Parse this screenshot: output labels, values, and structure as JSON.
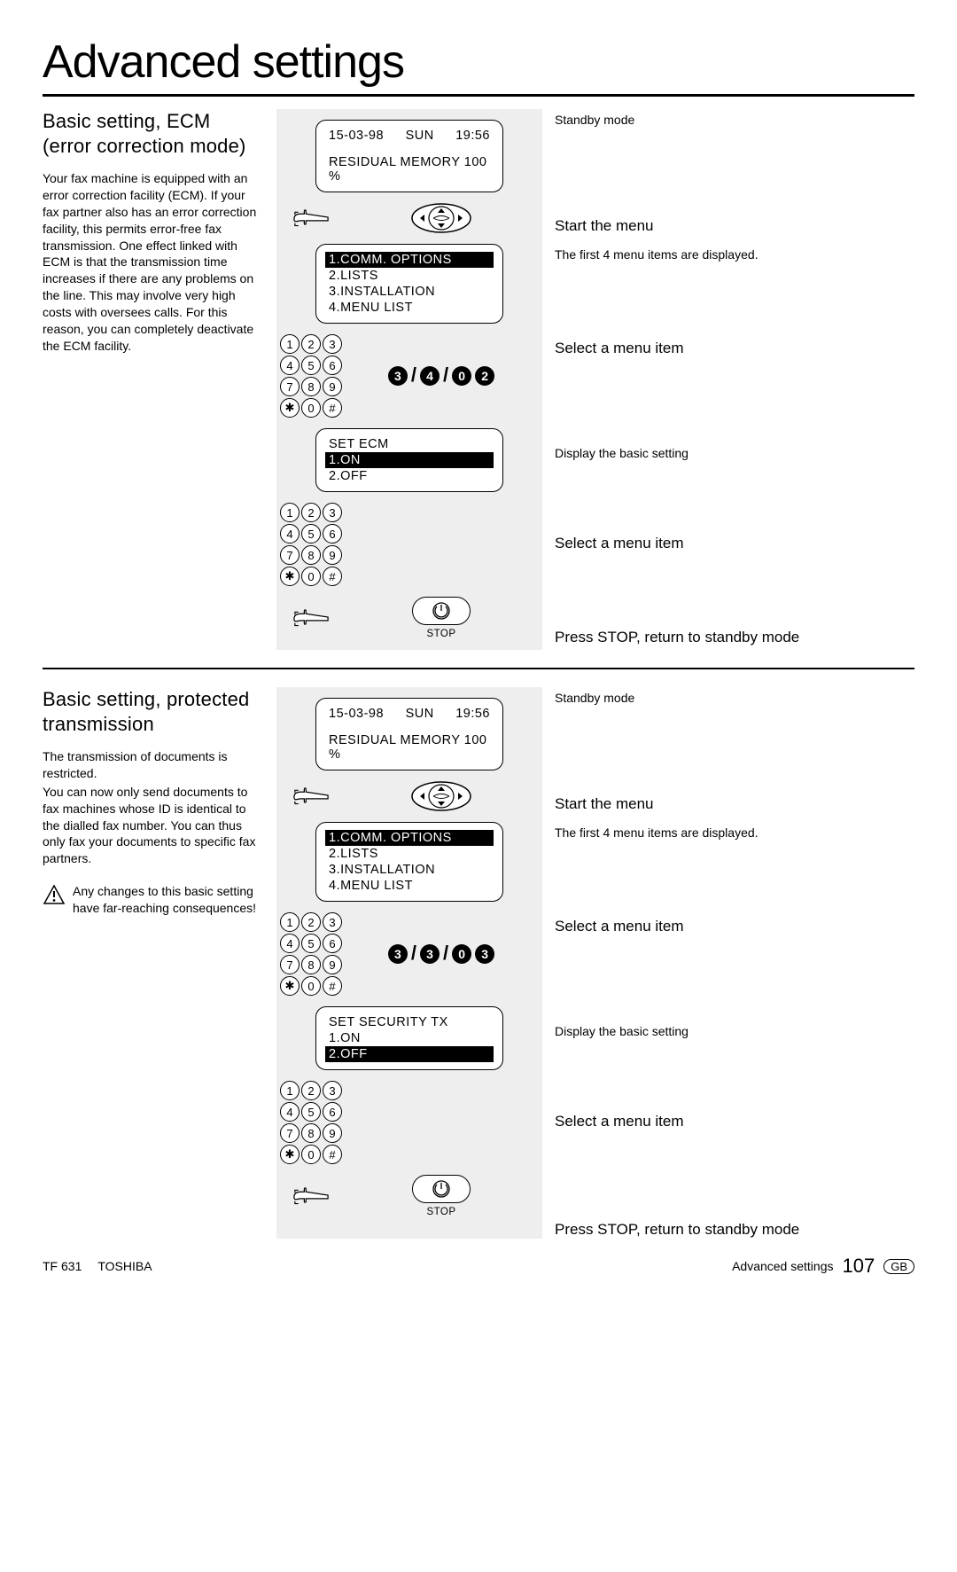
{
  "page_title": "Advanced settings",
  "section1": {
    "heading": "Basic setting, ECM (error correction mode)",
    "body": "Your fax machine is equipped with an error correction facility (ECM). If your fax partner also has an error correction facility, this permits error-free fax transmission. One effect linked with ECM is that the transmission time increases if there are any problems on the line. This may involve very high costs with oversees calls. For this reason, you can completely deactivate the ECM facility."
  },
  "section2": {
    "heading": "Basic setting, protected transmission",
    "body1": "The transmission of documents is restricted.",
    "body2": "You can now only send documents to fax machines whose ID is identical to the dialled fax number. You can thus only fax your documents to specific fax partners.",
    "warning": "Any changes to this basic setting have far-reaching consequences!"
  },
  "lcd_header": {
    "date": "15-03-98",
    "day": "SUN",
    "time": "19:56",
    "memory": "RESIDUAL MEMORY 100 %"
  },
  "menu_list": {
    "item1": "1.COMM. OPTIONS",
    "item2": "2.LISTS",
    "item3": "3.INSTALLATION",
    "item4": "4.MENU LIST"
  },
  "ecm_box": {
    "title": "SET ECM",
    "opt1": "1.ON",
    "opt2": "2.OFF"
  },
  "sec_box": {
    "title": "SET SECURITY TX",
    "opt1": "1.ON",
    "opt2": "2.OFF"
  },
  "key_seq1": {
    "a": "3",
    "b": "4",
    "c": "0",
    "d": "2"
  },
  "key_seq2": {
    "a": "3",
    "b": "3",
    "c": "0",
    "d": "3"
  },
  "stop_label": "STOP",
  "keypad": [
    "1",
    "2",
    "3",
    "4",
    "5",
    "6",
    "7",
    "8",
    "9",
    "✱",
    "0",
    "#"
  ],
  "right": {
    "standby": "Standby mode",
    "start_menu": "Start the menu",
    "first4": "The first 4 menu items are displayed.",
    "select": "Select a menu item",
    "display_basic": "Display the basic setting",
    "press_stop": "Press STOP, return to standby mode"
  },
  "footer": {
    "model": "TF 631",
    "brand": "TOSHIBA",
    "section": "Advanced settings",
    "page": "107",
    "lang": "GB"
  }
}
